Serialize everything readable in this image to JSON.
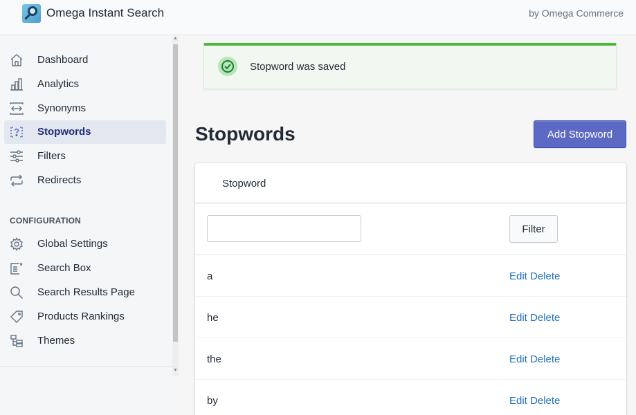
{
  "header": {
    "app_title": "Omega Instant Search",
    "byline": "by Omega Commerce",
    "logo_icon": "magnifier-logo-icon"
  },
  "sidebar": {
    "items": [
      {
        "label": "Dashboard",
        "icon": "home-icon"
      },
      {
        "label": "Analytics",
        "icon": "bar-chart-icon"
      },
      {
        "label": "Synonyms",
        "icon": "arrows-horizontal-icon"
      },
      {
        "label": "Stopwords",
        "icon": "question-box-icon",
        "active": true
      },
      {
        "label": "Filters",
        "icon": "sliders-icon"
      },
      {
        "label": "Redirects",
        "icon": "redirect-arrows-icon"
      }
    ],
    "config_section_title": "CONFIGURATION",
    "config_items": [
      {
        "label": "Global Settings",
        "icon": "gear-icon"
      },
      {
        "label": "Search Box",
        "icon": "search-box-icon"
      },
      {
        "label": "Search Results Page",
        "icon": "search-icon"
      },
      {
        "label": "Products Rankings",
        "icon": "tag-icon"
      },
      {
        "label": "Themes",
        "icon": "themes-icon"
      }
    ]
  },
  "banner": {
    "message": "Stopword was saved",
    "icon": "check-circle-icon",
    "accent_color": "#50b83c"
  },
  "page": {
    "title": "Stopwords",
    "add_button_label": "Add Stopword",
    "accent_color": "#5c6ac4"
  },
  "table": {
    "column_header": "Stopword",
    "filter_input_value": "",
    "filter_button_label": "Filter",
    "edit_label": "Edit",
    "delete_label": "Delete",
    "rows": [
      {
        "word": "a"
      },
      {
        "word": "he"
      },
      {
        "word": "the"
      },
      {
        "word": "by"
      }
    ]
  }
}
